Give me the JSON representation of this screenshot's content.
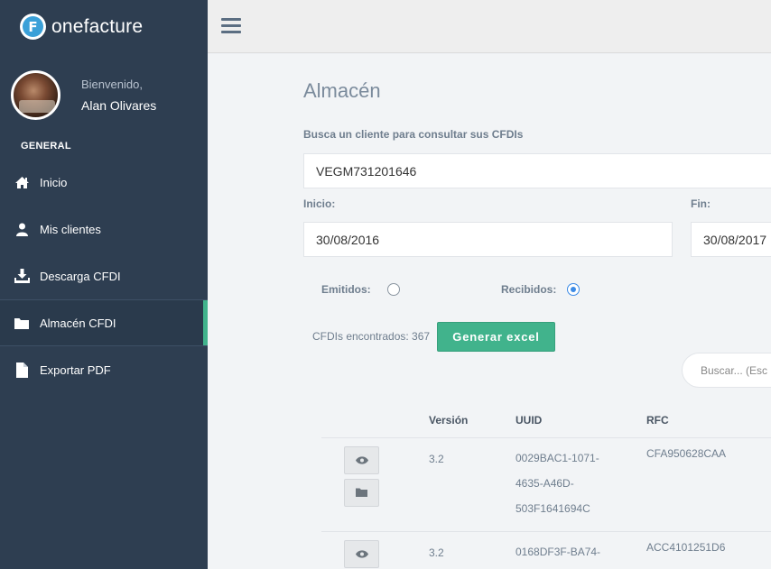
{
  "brand": {
    "logo_letter": "F",
    "name": "onefacture"
  },
  "profile": {
    "welcome": "Bienvenido,",
    "name": "Alan Olivares"
  },
  "sidebar": {
    "section": "GENERAL",
    "items": [
      {
        "label": "Inicio",
        "icon": "home-icon"
      },
      {
        "label": "Mis clientes",
        "icon": "user-icon"
      },
      {
        "label": "Descarga CFDI",
        "icon": "download-icon"
      },
      {
        "label": "Almacén CFDI",
        "icon": "folder-icon",
        "active": true
      },
      {
        "label": "Exportar PDF",
        "icon": "file-icon"
      }
    ]
  },
  "page": {
    "title": "Almacén",
    "search_client_label": "Busca un cliente para consultar sus CFDIs",
    "client_value": "VEGM731201646",
    "start_label": "Inicio:",
    "start_value": "30/08/2016",
    "end_label": "Fin:",
    "end_value": "30/08/2017",
    "emitidos_label": "Emitidos:",
    "recibidos_label": "Recibidos:",
    "selected_filter": "Recibidos",
    "count_text": "CFDIs encontrados: 367",
    "excel_button": "Generar excel",
    "search_placeholder": "Buscar... (Esc"
  },
  "table": {
    "headers": [
      "Versión",
      "UUID",
      "RFC"
    ],
    "rows": [
      {
        "version": "3.2",
        "uuid_lines": [
          "0029BAC1-1071-",
          "4635-A46D-",
          "503F1641694C"
        ],
        "rfc": "CFA950628CAA"
      },
      {
        "version": "3.2",
        "uuid_lines": [
          "0168DF3F-BA74-"
        ],
        "rfc": "ACC4101251D6"
      }
    ]
  },
  "colors": {
    "sidebar": "#2e3e51",
    "accent": "#41b38c",
    "radio": "#3d8be6"
  }
}
